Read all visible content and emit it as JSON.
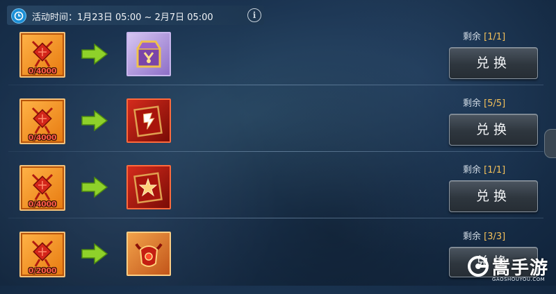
{
  "header": {
    "activity_time": "活动时间：1月23日 05:00 ~ 2月7日 05:00",
    "info_glyph": "i",
    "icon": "clock-icon"
  },
  "rows": [
    {
      "cost_count": "0/4000",
      "reward_icon": "treasure-chest-icon",
      "remain_label": "剩余",
      "remain_value": "[1/1]",
      "button_label": "兑换"
    },
    {
      "cost_count": "0/4000",
      "reward_icon": "red-rune-book-icon",
      "remain_label": "剩余",
      "remain_value": "[5/5]",
      "button_label": "兑换"
    },
    {
      "cost_count": "0/4000",
      "reward_icon": "red-star-book-icon",
      "remain_label": "剩余",
      "remain_value": "[1/1]",
      "button_label": "兑换"
    },
    {
      "cost_count": "0/2000",
      "reward_icon": "demon-helmet-icon",
      "remain_label": "剩余",
      "remain_value": "[3/3]",
      "button_label": "兑换"
    }
  ],
  "watermark": {
    "brand": "嵩手游",
    "url": "GAOSHOUYOU.COM"
  },
  "colors": {
    "accent_orange": "#e77a10",
    "count_red": "#ff5a4a",
    "remain_gold": "#f6c25a",
    "arrow_green": "#8fd12a"
  }
}
